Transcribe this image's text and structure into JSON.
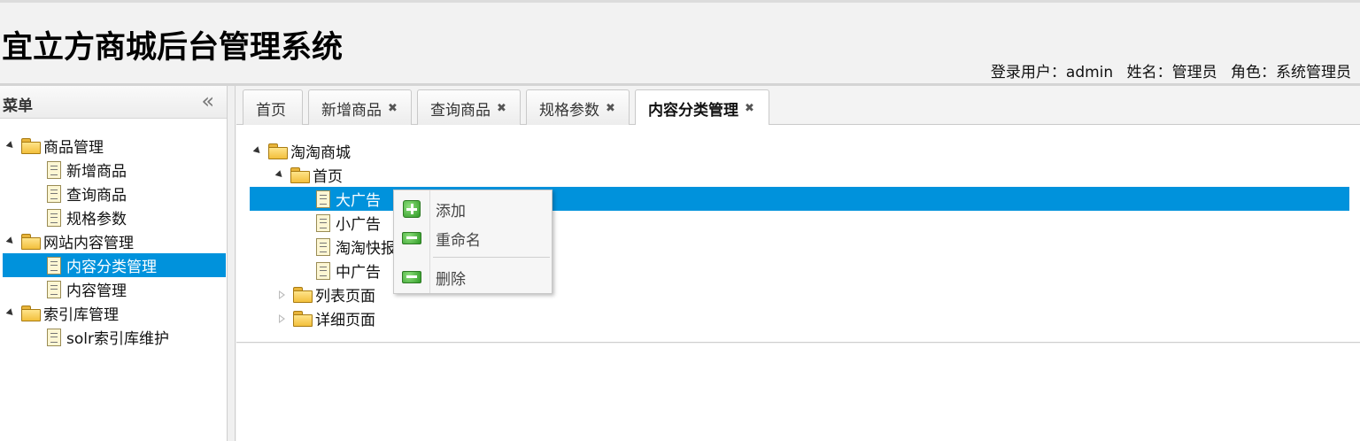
{
  "header": {
    "title": "宜立方商城后台管理系统",
    "user_label": "登录用户：admin",
    "name_label": "姓名：管理员",
    "role_label": "角色：系统管理员"
  },
  "sidebar": {
    "title": "菜单",
    "collapse_glyph": "«",
    "tree": {
      "goods_group": "商品管理",
      "add_goods": "新增商品",
      "query_goods": "查询商品",
      "spec_params": "规格参数",
      "content_group": "网站内容管理",
      "content_category": "内容分类管理",
      "content_manage": "内容管理",
      "index_group": "索引库管理",
      "solr_maint": "solr索引库维护"
    }
  },
  "tabs": [
    {
      "label": "首页",
      "closable": false
    },
    {
      "label": "新增商品",
      "closable": true
    },
    {
      "label": "查询商品",
      "closable": true
    },
    {
      "label": "规格参数",
      "closable": true
    },
    {
      "label": "内容分类管理",
      "closable": true,
      "active": true
    }
  ],
  "tab_close_glyph": "✖",
  "category_tree": {
    "root": "淘淘商城",
    "home": "首页",
    "big_ad": "大广告",
    "small_ad": "小广告",
    "taotao_quick": "淘淘快报",
    "mid_ad": "中广告",
    "list_page": "列表页面",
    "detail_page": "详细页面"
  },
  "context_menu": {
    "add": "添加",
    "rename": "重命名",
    "delete": "删除"
  },
  "colors": {
    "selection": "#0092dc",
    "icon_green": "#2f9a26"
  }
}
